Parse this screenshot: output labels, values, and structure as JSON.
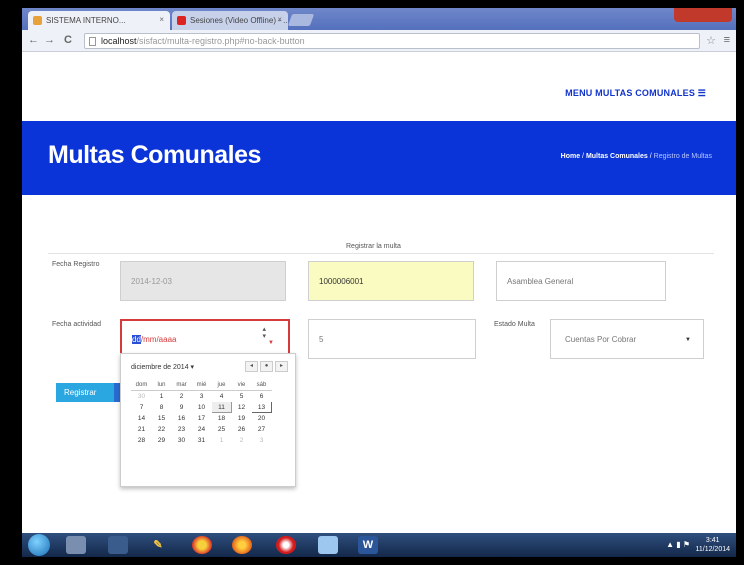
{
  "browser": {
    "tabs": [
      {
        "title": "SISTEMA INTERNO...",
        "close": "×"
      },
      {
        "title": "Sesiones (Video Offline) - ...",
        "close": "×"
      }
    ],
    "nav": {
      "back": "←",
      "forward": "→",
      "reload": "C"
    },
    "url_host": "localhost",
    "url_path": "/sisfact/multa-registro.php#no-back-button",
    "star": "☆",
    "menu": "≡"
  },
  "page": {
    "top_menu": "MENU MULTAS COMUNALES ☰",
    "title": "Multas Comunales",
    "breadcrumb": {
      "home": "Home",
      "sep1": " / ",
      "section": "Multas Comunales",
      "sep2": " / ",
      "current": "Registro de Multas"
    },
    "form_title": "Registrar la multa",
    "fields": {
      "fecha_registro_label": "Fecha Registro",
      "fecha_registro_value": "2014-12-03",
      "codigo_value": "1000006001",
      "motivo_value": "Asamblea General",
      "fecha_actividad_label": "Fecha actividad",
      "fecha_actividad_selected": "dd",
      "fecha_actividad_rest": "/mm/aaaa",
      "monto_value": "5",
      "estado_label": "Estado Multa",
      "estado_value": "Cuentas Por Cobrar"
    },
    "submit_label": "Registrar"
  },
  "calendar": {
    "month_label": "diciembre de 2014 ▾",
    "prev": "◂",
    "today_btn": "●",
    "next": "▸",
    "weekdays": [
      "dom",
      "lun",
      "mar",
      "mié",
      "jue",
      "vie",
      "sáb"
    ],
    "weeks": [
      [
        "30",
        "1",
        "2",
        "3",
        "4",
        "5",
        "6"
      ],
      [
        "7",
        "8",
        "9",
        "10",
        "11",
        "12",
        "13"
      ],
      [
        "14",
        "15",
        "16",
        "17",
        "18",
        "19",
        "20"
      ],
      [
        "21",
        "22",
        "23",
        "24",
        "25",
        "26",
        "27"
      ],
      [
        "28",
        "29",
        "30",
        "31",
        "1",
        "2",
        "3"
      ]
    ],
    "today": "11",
    "selected": "13"
  },
  "taskbar": {
    "word_label": "W",
    "clock_time": "3:41",
    "clock_date": "11/12/2014"
  }
}
